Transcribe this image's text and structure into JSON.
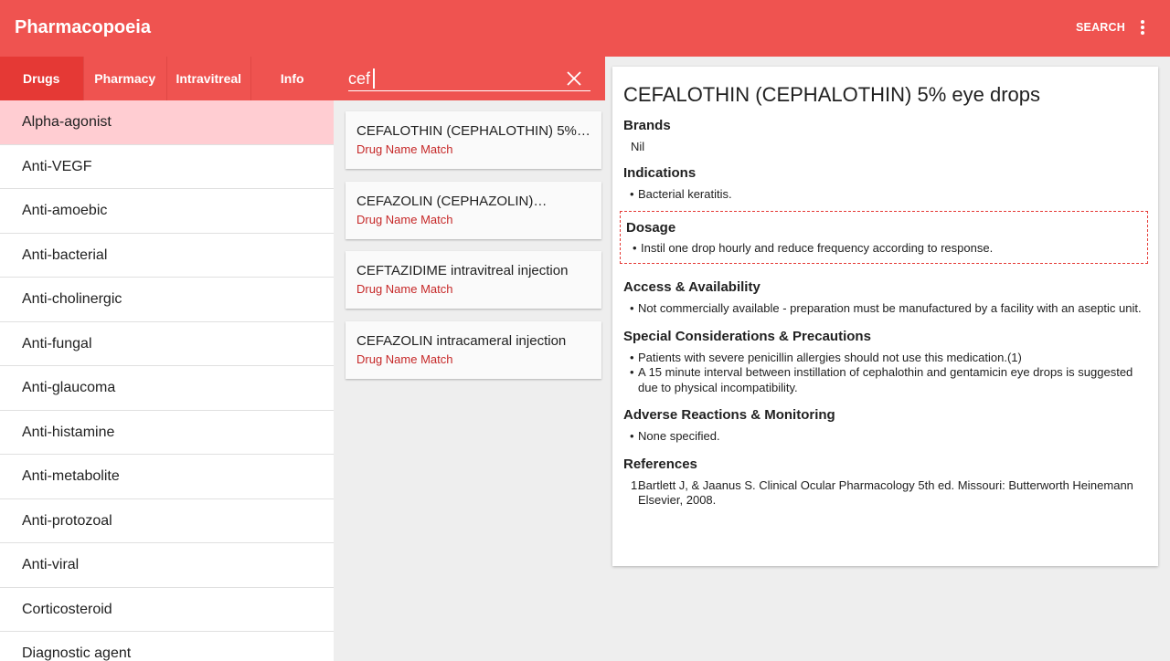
{
  "appbar": {
    "title": "Pharmacopoeia",
    "search_label": "SEARCH",
    "overflow_icon": "more-vert-icon",
    "color": "#ef5350"
  },
  "tabs": [
    {
      "label": "Drugs",
      "active": true
    },
    {
      "label": "Pharmacy",
      "active": false
    },
    {
      "label": "Intravitreal",
      "active": false
    },
    {
      "label": "Info",
      "active": false
    }
  ],
  "search": {
    "value": "cef",
    "placeholder": "",
    "clear_icon": "close-icon"
  },
  "categories": [
    "Alpha-agonist",
    "Anti-VEGF",
    "Anti-amoebic",
    "Anti-bacterial",
    "Anti-cholinergic",
    "Anti-fungal",
    "Anti-glaucoma",
    "Anti-histamine",
    "Anti-metabolite",
    "Anti-protozoal",
    "Anti-viral",
    "Corticosteroid",
    "Diagnostic agent"
  ],
  "selected_category": "Alpha-agonist",
  "results": [
    {
      "title": "CEFALOTHIN (CEPHALOTHIN) 5%…",
      "match": "Drug Name Match"
    },
    {
      "title": "CEFAZOLIN (CEPHAZOLIN)…",
      "match": "Drug Name Match"
    },
    {
      "title": "CEFTAZIDIME intravitreal injection",
      "match": "Drug Name Match"
    },
    {
      "title": "CEFAZOLIN intracameral injection",
      "match": "Drug Name Match"
    }
  ],
  "detail": {
    "title": "CEFALOTHIN (CEPHALOTHIN) 5% eye drops",
    "brands": {
      "heading": "Brands",
      "value": "Nil"
    },
    "indications": {
      "heading": "Indications",
      "items": [
        "Bacterial keratitis."
      ]
    },
    "dosage": {
      "heading": "Dosage",
      "items": [
        "Instil one drop hourly and reduce frequency according to response."
      ]
    },
    "access": {
      "heading": "Access & Availability",
      "items": [
        "Not commercially available - preparation must be manufactured by a facility with an aseptic unit."
      ]
    },
    "special": {
      "heading": "Special Considerations & Precautions",
      "items": [
        "Patients with severe penicillin allergies should not use this medication.(1)",
        "A 15 minute interval between instillation of cephalothin and gentamicin eye drops is suggested due to physical incompatibility."
      ]
    },
    "adverse": {
      "heading": "Adverse Reactions & Monitoring",
      "items": [
        "None specified."
      ]
    },
    "references": {
      "heading": "References",
      "items": [
        {
          "num": "1.",
          "text": "Bartlett J, & Jaanus S. Clinical Ocular Pharmacology 5th ed. Missouri: Butterworth Heinemann Elsevier, 2008."
        }
      ]
    }
  }
}
